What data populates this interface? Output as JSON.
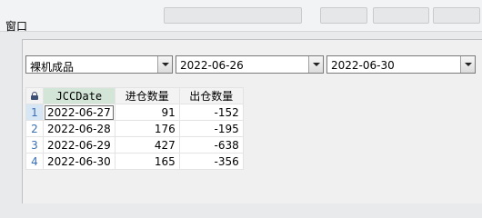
{
  "window": {
    "title": "窗口"
  },
  "filters": {
    "product": "裸机成品",
    "start_date": "2022-06-26",
    "end_date": "2022-06-30"
  },
  "grid": {
    "columns": [
      "JCCDate",
      "进仓数量",
      "出仓数量"
    ],
    "rows": [
      {
        "no": "1",
        "date": "2022-06-27",
        "in": "91",
        "out": "-152"
      },
      {
        "no": "2",
        "date": "2022-06-28",
        "in": "176",
        "out": "-195"
      },
      {
        "no": "3",
        "date": "2022-06-29",
        "in": "427",
        "out": "-638"
      },
      {
        "no": "4",
        "date": "2022-06-30",
        "in": "165",
        "out": "-356"
      }
    ]
  },
  "icons": {
    "lock": "lock-icon",
    "dropdown": "chevron-down-icon"
  }
}
